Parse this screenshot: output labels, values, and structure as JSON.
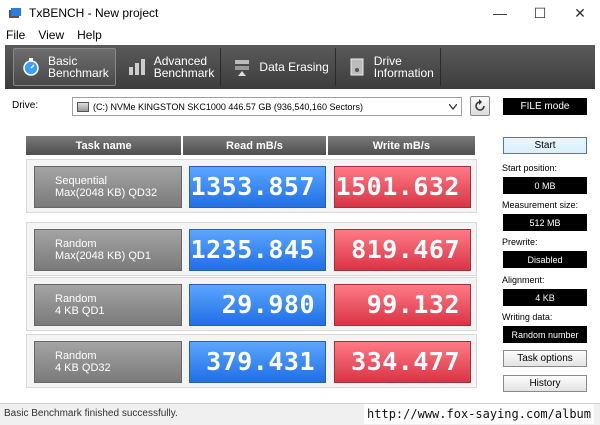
{
  "window": {
    "title": "TxBENCH - New project"
  },
  "menu": [
    "File",
    "View",
    "Help"
  ],
  "toolbar": {
    "basic": [
      "Basic",
      "Benchmark"
    ],
    "advanced": [
      "Advanced",
      "Benchmark"
    ],
    "erasing": "Data Erasing",
    "drive_info": [
      "Drive",
      "Information"
    ]
  },
  "drive": {
    "label": "Drive:",
    "selected": "(C:) NVMe KINGSTON SKC1000  446.57 GB (936,540,160 Sectors)",
    "mode": "FILE mode"
  },
  "table": {
    "headers": [
      "Task name",
      "Read mB/s",
      "Write mB/s"
    ],
    "rows": [
      {
        "name": [
          "Sequential",
          "Max(2048 KB) QD32"
        ],
        "read": "1353.857",
        "write": "1501.632"
      },
      {
        "name": [
          "Random",
          "Max(2048 KB) QD1"
        ],
        "read": "1235.845",
        "write": "819.467"
      },
      {
        "name": [
          "Random",
          "4 KB QD1"
        ],
        "read": "29.980",
        "write": "99.132"
      },
      {
        "name": [
          "Random",
          "4 KB QD32"
        ],
        "read": "379.431",
        "write": "334.477"
      }
    ]
  },
  "panel": {
    "start": "Start",
    "start_position_label": "Start position:",
    "start_position": "0 MB",
    "measurement_size_label": "Measurement size:",
    "measurement_size": "512 MB",
    "prewrite_label": "Prewrite:",
    "prewrite": "Disabled",
    "alignment_label": "Alignment:",
    "alignment": "4 KB",
    "writing_data_label": "Writing data:",
    "writing_data": "Random number",
    "task_options": "Task options",
    "history": "History"
  },
  "status": {
    "message": "Basic Benchmark finished successfully.",
    "watermark": "http://www.fox-saying.com/album"
  },
  "colors": {
    "read": "#1f6fe6",
    "write": "#d93445",
    "toolbar": "#4a4a4a"
  }
}
